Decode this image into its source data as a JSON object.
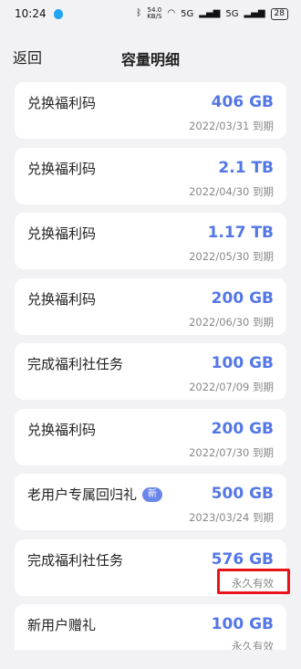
{
  "status_bar": {
    "time": "10:24",
    "net_speed_value": "54.0",
    "net_speed_unit": "KB/S",
    "signal_label_1": "5G",
    "signal_label_2": "5G",
    "battery": "28"
  },
  "nav": {
    "back_label": "返回",
    "title": "容量明细"
  },
  "items": [
    {
      "title": "兑换福利码",
      "amount": "406 GB",
      "date": "2022/03/31 到期"
    },
    {
      "title": "兑换福利码",
      "amount": "2.1 TB",
      "date": "2022/04/30 到期"
    },
    {
      "title": "兑换福利码",
      "amount": "1.17 TB",
      "date": "2022/05/30 到期"
    },
    {
      "title": "兑换福利码",
      "amount": "200 GB",
      "date": "2022/06/30 到期"
    },
    {
      "title": "完成福利社任务",
      "amount": "100 GB",
      "date": "2022/07/09 到期"
    },
    {
      "title": "兑换福利码",
      "amount": "200 GB",
      "date": "2022/07/30 到期"
    },
    {
      "title": "老用户专属回归礼",
      "badge": "新",
      "amount": "500 GB",
      "date": "2023/03/24 到期"
    },
    {
      "title": "完成福利社任务",
      "amount": "576 GB",
      "date": "永久有效"
    },
    {
      "title": "新用户赠礼",
      "amount": "100 GB",
      "date": "永久有效"
    }
  ],
  "colors": {
    "accent": "#5477e6",
    "highlight_box": "#e8141b",
    "background": "#f2f2f4"
  }
}
